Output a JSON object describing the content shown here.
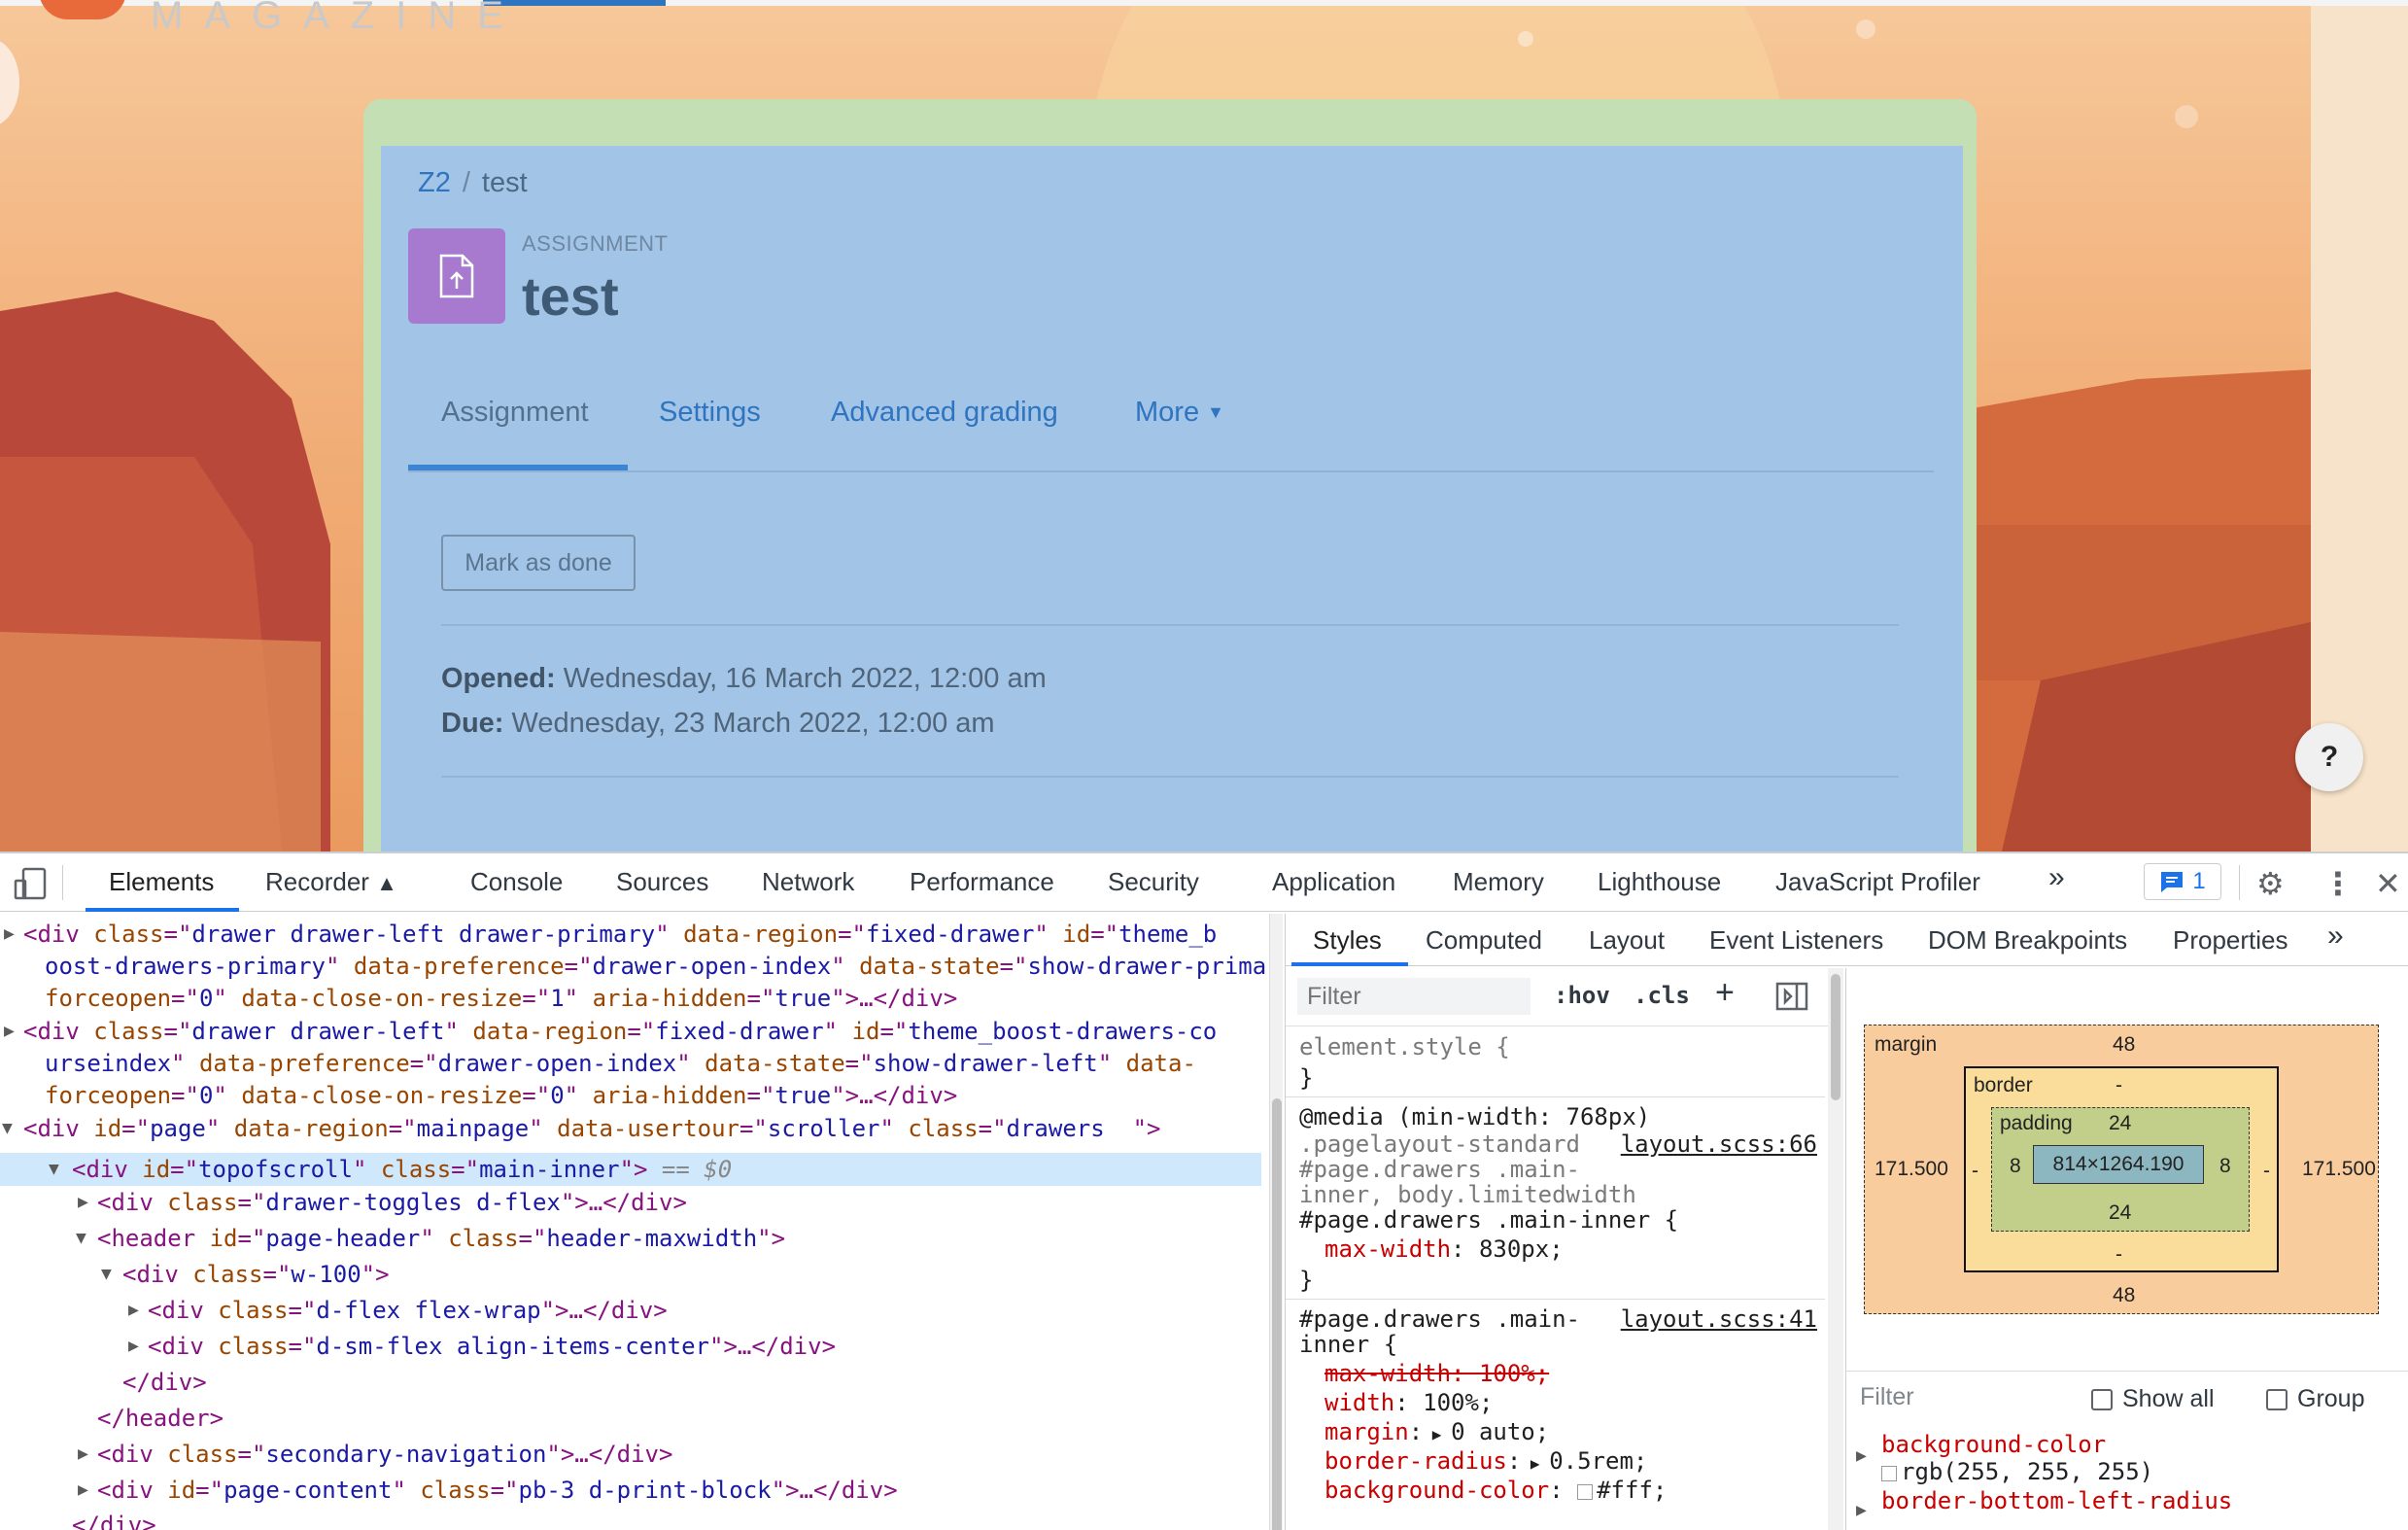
{
  "page": {
    "logo_text": "MAGAZINE",
    "breadcrumb": {
      "course": "Z2",
      "separator": "/",
      "current": "test"
    },
    "activity": {
      "type_label": "ASSIGNMENT",
      "title": "test",
      "icon": "upload-file-icon",
      "icon_color": "#a77ad0"
    },
    "tabs": [
      {
        "label": "Assignment",
        "active": true
      },
      {
        "label": "Settings"
      },
      {
        "label": "Advanced grading"
      },
      {
        "label": "More"
      }
    ],
    "mark_done_label": "Mark as done",
    "dates": {
      "opened_label": "Opened:",
      "opened_value": "Wednesday, 16 March 2022, 12:00 am",
      "due_label": "Due:",
      "due_value": "Wednesday, 23 March 2022, 12:00 am"
    },
    "help_label": "?"
  },
  "devtools": {
    "tabs": [
      "Elements",
      "Recorder",
      "Console",
      "Sources",
      "Network",
      "Performance",
      "Security",
      "Application",
      "Memory",
      "Lighthouse",
      "JavaScript Profiler"
    ],
    "more_tabs": "»",
    "issues_count": "1",
    "styles_tabs": [
      "Styles",
      "Computed",
      "Layout",
      "Event Listeners",
      "DOM Breakpoints",
      "Properties"
    ],
    "styles_more": "»",
    "filter_placeholder": "Filter",
    "hov": ":hov",
    "cls": ".cls",
    "plus": "+",
    "dom": {
      "l1a": "<div ",
      "l1b": "class",
      "l1c": "=\"",
      "l1d": "drawer drawer-left drawer-primary",
      "l1e": "\" ",
      "l1f": "data-region",
      "l1g": "fixed-drawer",
      "l1h": "id",
      "l1i": "theme_b",
      "l2": "oost-drawers-primary",
      "l2b": "data-preference",
      "l2c": "drawer-open-index",
      "l2d": "data-state",
      "l2e": "show-drawer-primary",
      "l2f": "data-",
      "l3a": "forceopen",
      "l3b": "0",
      "l3c": "data-close-on-resize",
      "l3d": "1",
      "l3e": "aria-hidden",
      "l3f": "true",
      "l3g": ">…</div>",
      "l4d": "drawer drawer-left",
      "l4i": "theme_boost-drawers-co",
      "l5": "urseindex",
      "l5e": "show-drawer-left",
      "l6b": "0",
      "l7a": "page",
      "l7b": "data-region",
      "l7c": "mainpage",
      "l7d": "data-usertour",
      "l7e": "scroller",
      "l7f": "drawers  ",
      "l8a": "topofscroll",
      "l8b": "main-inner",
      "l8c": " == $0",
      "l9": "drawer-toggles d-flex",
      "l10a": "page-header",
      "l10b": "header-maxwidth",
      "l11": "w-100",
      "l12": "d-flex flex-wrap",
      "l13": "d-sm-flex align-items-center",
      "l14": "</div>",
      "l15": "</header>",
      "l16": "secondary-navigation",
      "l17a": "page-content",
      "l17b": "pb-3 d-print-block",
      "l18": "</div>"
    },
    "css": {
      "element_style": "element.style {",
      "close": "}",
      "media": "@media (min-width: 768px)",
      "sel1a": ".pagelayout-standard",
      "sel1b": "#page.drawers .main-",
      "sel1c": "inner, body.limitedwidth",
      "sel1d": "#page.drawers .main-inner {",
      "src1": "layout.scss:66",
      "p_maxwidth": "max-width",
      "v_830": "830px;",
      "sel2a": "#page.drawers .main-",
      "sel2b": "inner {",
      "src2": "layout.scss:41",
      "struck": "max-width: 100%;",
      "p_width": "width",
      "v_width": "100%;",
      "p_margin": "margin",
      "v_margin": "0 auto;",
      "p_radius": "border-radius",
      "v_radius": "0.5rem;",
      "p_bg": "background-color",
      "v_bg": "#fff;"
    },
    "box_model": {
      "margin_label": "margin",
      "margin_top": "48",
      "margin_bottom": "48",
      "margin_left": "171.500",
      "margin_right": "171.500",
      "border_label": "border",
      "border_top": "-",
      "border_bottom": "-",
      "border_left": "-",
      "border_right": "-",
      "padding_label": "padding",
      "padding_top": "24",
      "padding_bottom": "24",
      "padding_left": "8",
      "padding_right": "8",
      "content": "814×1264.190"
    },
    "computed": {
      "filter": "Filter",
      "show_all": "Show all",
      "group": "Group",
      "prop1": "background-color",
      "val1": "rgb(255, 255, 255)",
      "prop2": "border-bottom-left-radius"
    }
  }
}
